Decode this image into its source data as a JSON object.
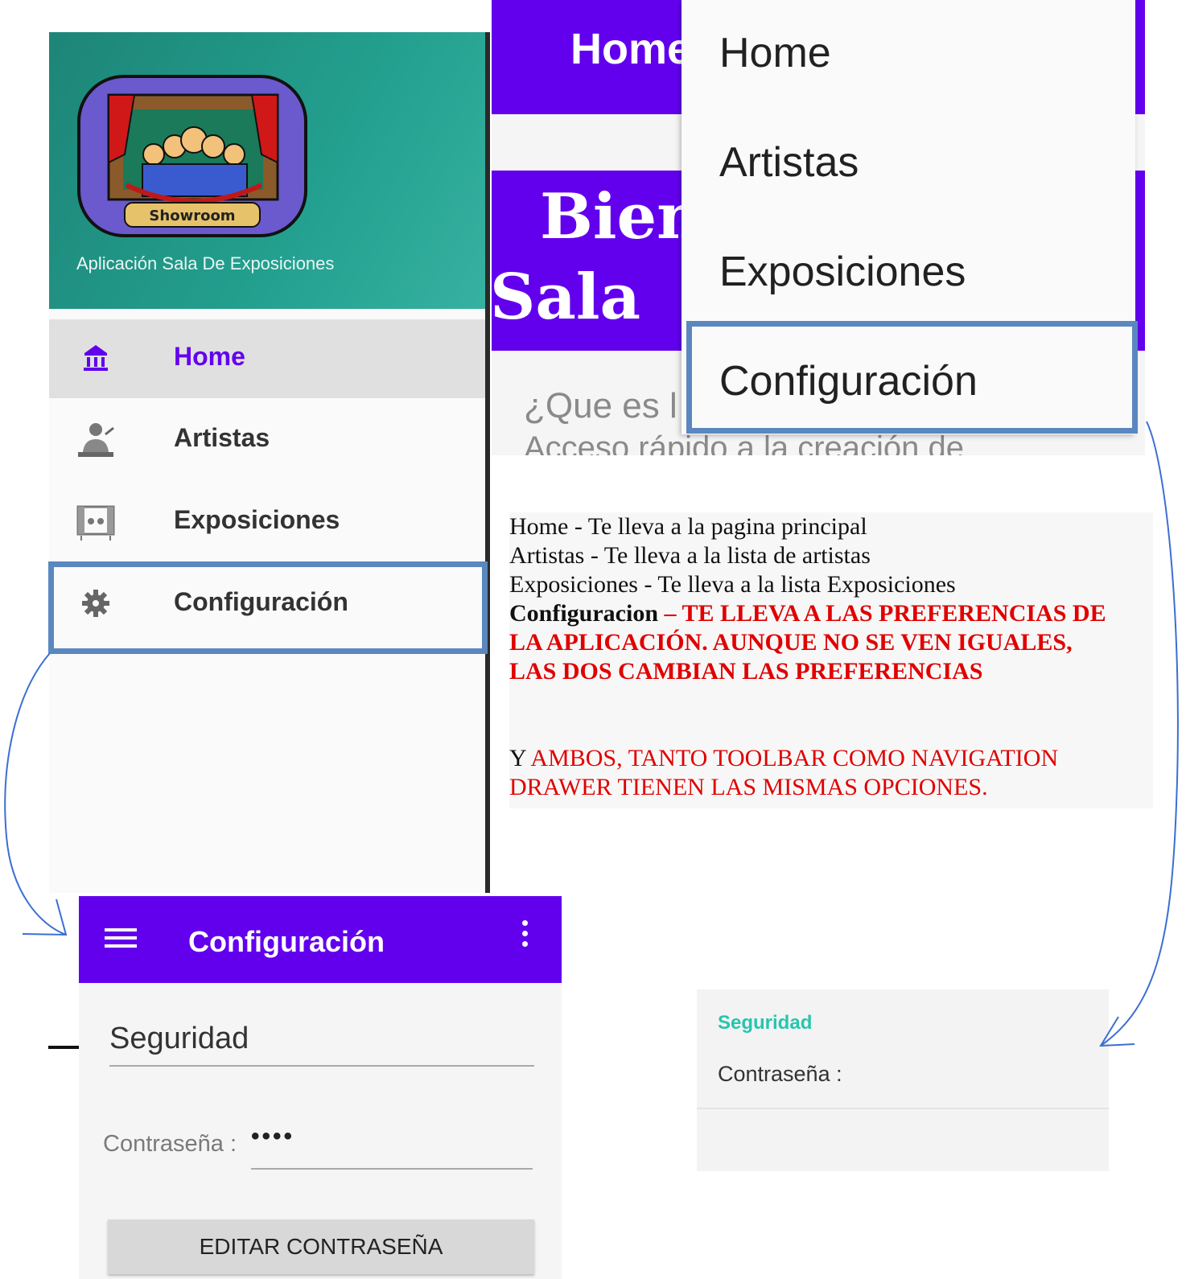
{
  "app_screen": {
    "toolbar_title": "Home",
    "banner_line1": "Bien",
    "banner_line2": "Sala",
    "question_text": "¿Que es l",
    "quick_access_text": "Acceso rápido a la creación de"
  },
  "popup_menu": {
    "items": [
      "Home",
      "Artistas",
      "Exposiciones",
      "Configuración"
    ]
  },
  "drawer": {
    "logo_text": "Showroom",
    "subtitle": "Aplicación Sala De Exposiciones",
    "items": [
      {
        "label": "Home",
        "icon": "bank-icon"
      },
      {
        "label": "Artistas",
        "icon": "artist-icon"
      },
      {
        "label": "Exposiciones",
        "icon": "exhibition-icon"
      },
      {
        "label": "Configuración",
        "icon": "gear-icon"
      }
    ]
  },
  "config_screen": {
    "toolbar_title": "Configuración",
    "section_heading": "Seguridad",
    "password_label": "Contraseña :",
    "password_value": "••••",
    "edit_button_label": "EDITAR CONTRASEÑA"
  },
  "notes": {
    "line1": "Home   - Te lleva a la pagina principal",
    "line2": "Artistas - Te lleva a la lista de artistas",
    "line3": "Exposiciones - Te lleva a la lista Exposiciones",
    "config_term": "Configuracion",
    "config_desc1": " – TE LLEVA A LAS PREFERENCIAS DE",
    "config_desc2": "LA APLICACIÓN. AUNQUE NO SE VEN IGUALES,",
    "config_desc3": "LAS DOS CAMBIAN LAS PREFERENCIAS",
    "y_prefix": "Y ",
    "both_line1": "AMBOS, TANTO TOOLBAR COMO NAVIGATION",
    "both_line2": "DRAWER TIENEN LAS MISMAS OPCIONES."
  },
  "preferences_panel": {
    "category": "Seguridad",
    "password_label": "Contraseña :"
  },
  "colors": {
    "primary": "#6200ee",
    "drawer_header": "#1d8578",
    "highlight_box": "#5a87c0",
    "annotation_red": "#e00000",
    "preference_accent": "#26c6ad"
  }
}
